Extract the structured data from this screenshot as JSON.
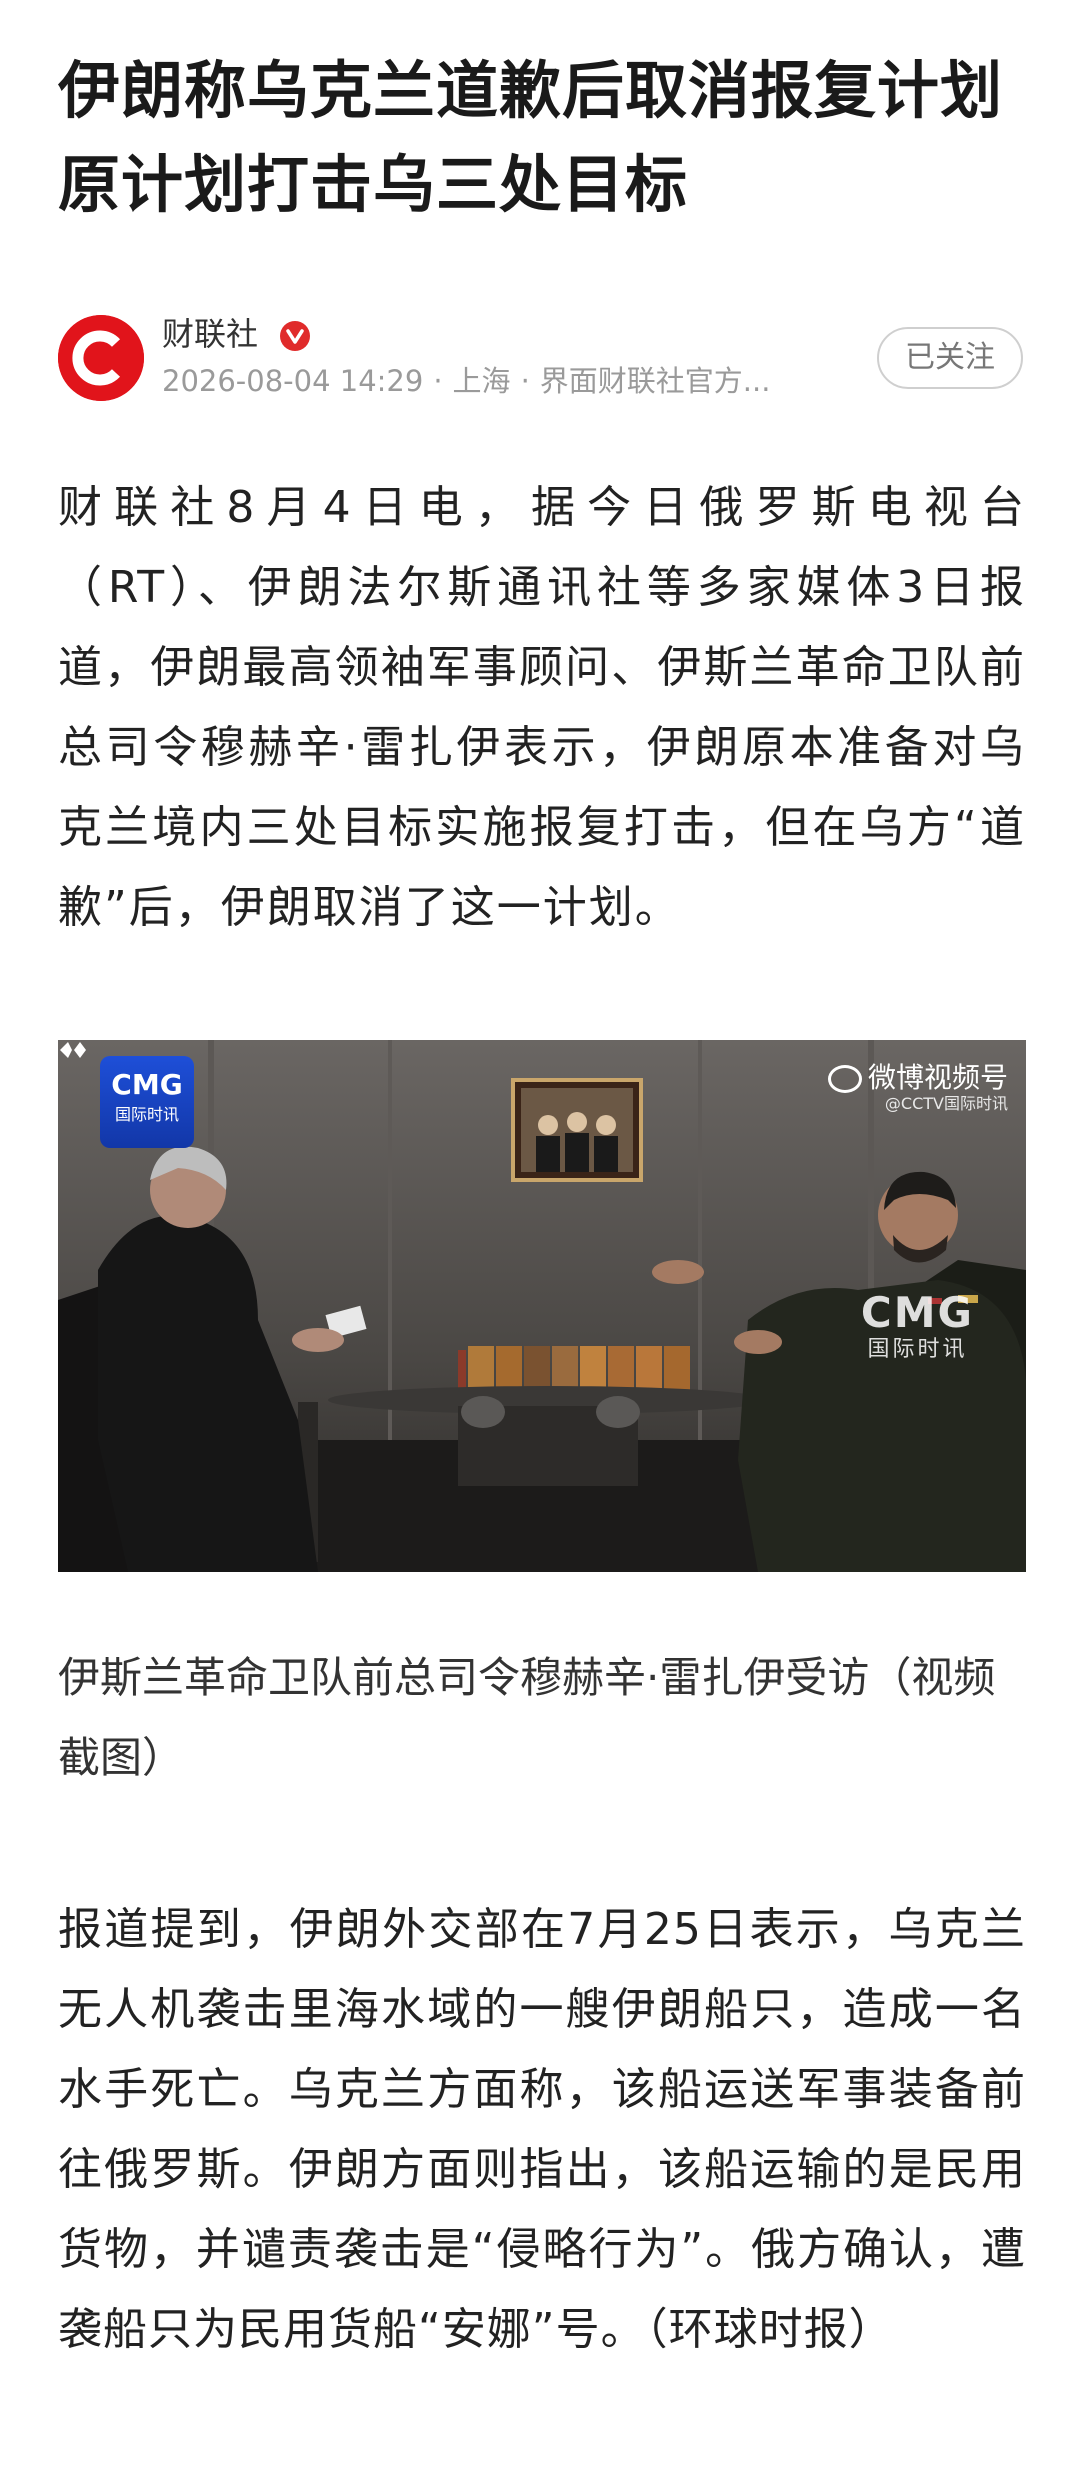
{
  "article": {
    "headline": "伊朗称乌克兰道歉后取消报复计划 原计划打击乌三处目标"
  },
  "author": {
    "name": "财联社",
    "date": "2026-08-04 14:29",
    "location": "上海",
    "source": "界面财联社官方...",
    "follow_label": "已关注"
  },
  "body": {
    "paragraph1": "财联社8月4日电，据今日俄罗斯电视台（RT）、伊朗法尔斯通讯社等多家媒体3日报道，伊朗最高领袖军事顾问、伊斯兰革命卫队前总司令穆赫辛·雷扎伊表示，伊朗原本准备对乌克兰境内三处目标实施报复打击，但在乌方“道歉”后，伊朗取消了这一计划。",
    "caption": "伊斯兰革命卫队前总司令穆赫辛·雷扎伊受访（视频截图）",
    "paragraph2": "报道提到，伊朗外交部在7月25日表示，乌克兰无人机袭击里海水域的一艘伊朗船只，造成一名水手死亡。乌克兰方面称，该船运送军事装备前往俄罗斯。伊朗方面则指出，该船运输的是民用货物，并谴责袭击是“侵略行为”。俄方确认，遭袭船只为民用货船“安娜”号。（环球时报）"
  },
  "video": {
    "badge_line1": "CMG",
    "badge_line2": "国际时讯",
    "watermark_line1": "微博视频号",
    "watermark_line2": "@CCTV国际时讯",
    "logo_line1": "CMG",
    "logo_line2": "国际时讯"
  },
  "colors": {
    "brand_red": "#e1141b",
    "meta_gray": "#9a9a9a"
  }
}
